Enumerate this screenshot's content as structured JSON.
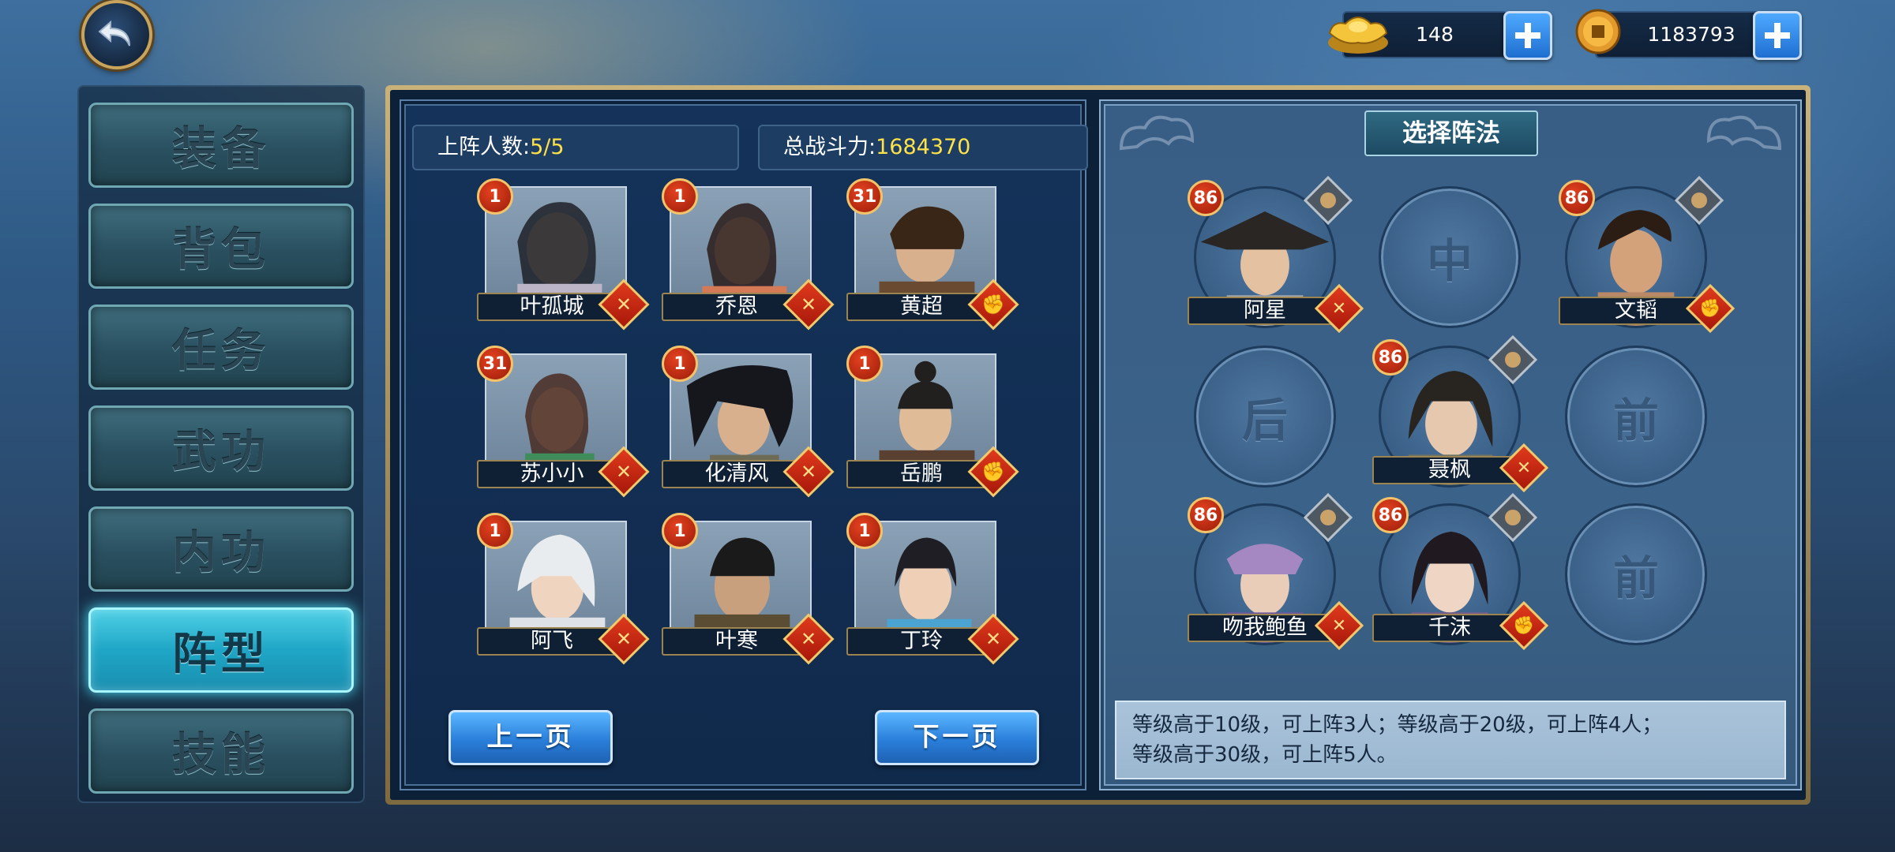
{
  "currency": {
    "gold_ingot": {
      "value": "148",
      "icon": "gold-ingot-icon"
    },
    "copper_coin": {
      "value": "1183793",
      "icon": "copper-coin-icon"
    }
  },
  "nav": {
    "items": [
      {
        "label": "装备",
        "active": false
      },
      {
        "label": "背包",
        "active": false
      },
      {
        "label": "任务",
        "active": false
      },
      {
        "label": "武功",
        "active": false
      },
      {
        "label": "内功",
        "active": false
      },
      {
        "label": "阵型",
        "active": true
      },
      {
        "label": "技能",
        "active": false
      }
    ]
  },
  "roster": {
    "deployed_label": "上阵人数:",
    "deployed_value": "5/5",
    "power_label": "总战斗力:",
    "power_value": "1684370",
    "heroes": [
      {
        "name": "叶孤城",
        "level": "1",
        "role": "sword"
      },
      {
        "name": "乔恩",
        "level": "1",
        "role": "sword"
      },
      {
        "name": "黄超",
        "level": "31",
        "role": "fist"
      },
      {
        "name": "苏小小",
        "level": "31",
        "role": "sword"
      },
      {
        "name": "化清风",
        "level": "1",
        "role": "sword"
      },
      {
        "name": "岳鹏",
        "level": "1",
        "role": "fist"
      },
      {
        "name": "阿飞",
        "level": "1",
        "role": "sword"
      },
      {
        "name": "叶寒",
        "level": "1",
        "role": "sword"
      },
      {
        "name": "丁玲",
        "level": "1",
        "role": "sword"
      }
    ],
    "prev_label": "上一页",
    "next_label": "下一页"
  },
  "formation": {
    "title": "选择阵法",
    "slots": {
      "middle": "中",
      "back": "后",
      "front_1": "前",
      "front_2": "前"
    },
    "heroes": [
      {
        "name": "阿星",
        "level": "86",
        "role": "sword"
      },
      {
        "name": "文韬",
        "level": "86",
        "role": "fist"
      },
      {
        "name": "聂枫",
        "level": "86",
        "role": "sword"
      },
      {
        "name": "吻我鲍鱼",
        "level": "86",
        "role": "sword"
      },
      {
        "name": "千沫",
        "level": "86",
        "role": "fist"
      }
    ],
    "info_line1": "等级高于10级，可上阵3人；等级高于20级，可上阵4人；",
    "info_line2": "等级高于30级，可上阵5人。"
  },
  "colors": {
    "accent_blue": "#2a7fda",
    "level_red": "#c52a12",
    "highlight_yellow": "#ffe14a",
    "active_nav": "#1fa6c6"
  }
}
